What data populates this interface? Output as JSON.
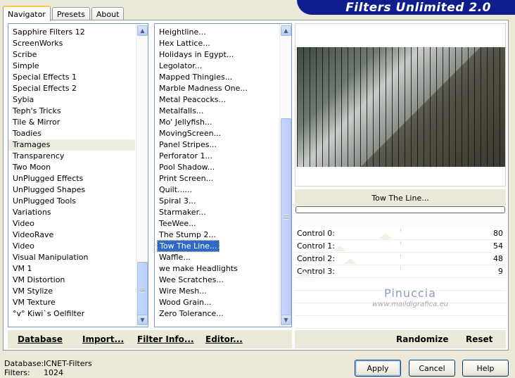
{
  "window": {
    "title": "Filters Unlimited 2.0"
  },
  "tabs": [
    {
      "label": "Navigator",
      "active": true
    },
    {
      "label": "Presets",
      "active": false
    },
    {
      "label": "About",
      "active": false
    }
  ],
  "categories": [
    "Sapphire Filters 12",
    "ScreenWorks",
    "Scribe",
    "Simple",
    "Special Effects 1",
    "Special Effects 2",
    "Sybia",
    "Teph's Tricks",
    "Tile & Mirror",
    "Toadies",
    "Tramages",
    "Transparency",
    "Two Moon",
    "UnPlugged Effects",
    "UnPlugged Shapes",
    "UnPlugged Tools",
    "Variations",
    "Video",
    "VideoRave",
    "Video",
    "Visual Manipulation",
    "VM 1",
    "VM Distortion",
    "VM Stylize",
    "VM Texture",
    "°v° Kiwi`s Oelfilter"
  ],
  "highlighted_category": "Tramages",
  "filters": [
    "Heightline...",
    "Hex Lattice...",
    "Holidays in Egypt...",
    "Legolator...",
    "Mapped Thingies...",
    "Marble Madness One...",
    "Metal Peacocks...",
    "Metalfalls...",
    "Mo' Jellyfish...",
    "MovingScreen...",
    "Panel Stripes...",
    "Perforator 1...",
    "Pool Shadow...",
    "Print Screen...",
    "Quilt......",
    "Spiral 3...",
    "Starmaker...",
    "TeeWee...",
    "The Stump 2...",
    "Tow The Line...",
    "Waffle...",
    "we make Headlights",
    "Wee Scratches...",
    "Wire Mesh...",
    "Wood Grain...",
    "Zero Tolerance..."
  ],
  "selected_filter": "Tow The Line...",
  "preview": {
    "filter_name": "Tow The Line...",
    "progress": 0
  },
  "controls": [
    {
      "label": "Control 0:",
      "value": "80"
    },
    {
      "label": "Control 1:",
      "value": "54"
    },
    {
      "label": "Control 2:",
      "value": "48"
    },
    {
      "label": "Control 3:",
      "value": "9"
    }
  ],
  "watermark": {
    "name": "Pinuccia",
    "url": "www.maildigrafica.eu"
  },
  "left_actions": {
    "database": "Database",
    "import": "Import...",
    "filter_info": "Filter Info...",
    "editor": "Editor..."
  },
  "right_actions": {
    "randomize": "Randomize",
    "reset": "Reset"
  },
  "status": {
    "database_label": "Database:",
    "database_value": "ICNET-Filters",
    "filters_label": "Filters:",
    "filters_value": "1024"
  },
  "buttons": {
    "apply": "Apply",
    "cancel": "Cancel",
    "help": "Help"
  }
}
